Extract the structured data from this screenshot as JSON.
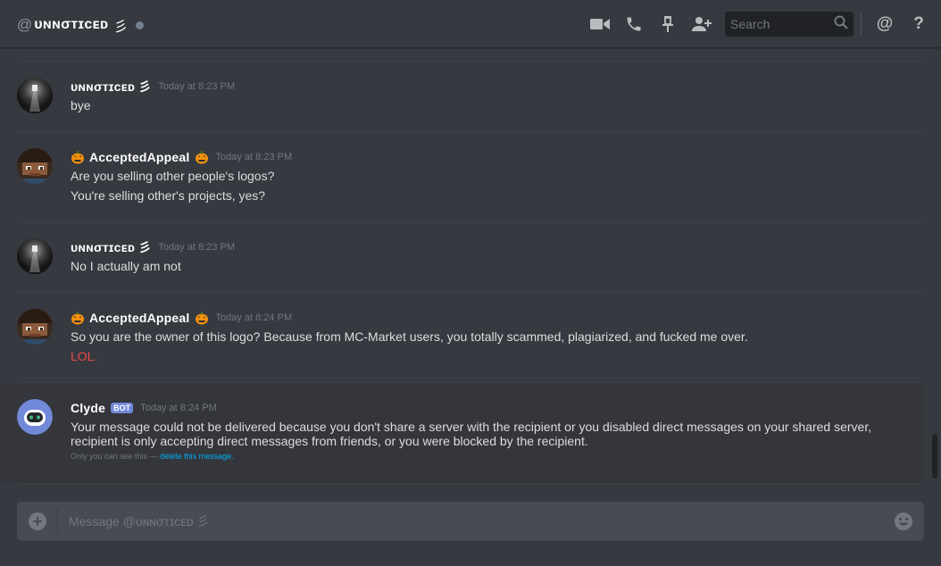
{
  "header": {
    "at_symbol": "@",
    "channel_name": "ᴜɴɴσᴛɪcᴇᴅ",
    "channel_suffix": "彡",
    "status_color": "#747f8d",
    "search_placeholder": "Search",
    "icons": [
      "video-call-icon",
      "voice-call-icon",
      "pin-icon",
      "add-friend-icon",
      "search-icon",
      "mention-icon",
      "help-icon"
    ],
    "mention_label": "@",
    "help_label": "?"
  },
  "messages": [
    {
      "author": "ᴜɴɴσᴛɪcᴇᴅ 彡",
      "timestamp": "Today at 8:23 PM",
      "lines": [
        "bye"
      ]
    },
    {
      "author": "AcceptedAppeal",
      "timestamp": "Today at 8:23 PM",
      "lines": [
        "Are you selling other people's logos?",
        "You're selling other's projects, yes?"
      ]
    },
    {
      "author": "ᴜɴɴσᴛɪcᴇᴅ 彡",
      "timestamp": "Today at 8:23 PM",
      "lines": [
        "No I actually am not"
      ]
    },
    {
      "author": "AcceptedAppeal",
      "timestamp": "Today at 8:24 PM",
      "lines": [
        "So you are the owner of this logo? Because from MC-Market users, you totally scammed, plagiarized, and fucked me over.",
        "LOL."
      ]
    },
    {
      "author": "Clyde",
      "bot_tag": "BOT",
      "timestamp": "Today at 8:24 PM",
      "lines": [
        "Your message could not be delivered because you don't share a server with the recipient or you disabled direct messages on your shared server, recipient is only accepting direct messages from friends, or you were blocked by the recipient."
      ],
      "ephemeral_text": "Only you can see this — ",
      "ephemeral_link": "delete this message."
    }
  ],
  "input": {
    "placeholder": "Message @ᴜɴɴσᴛɪcᴇᴅ 彡"
  },
  "colors": {
    "background": "#36393f",
    "header_border": "#28292d",
    "input_bg": "#484b51",
    "timestamp": "#72767d",
    "red_text": "#f04747",
    "link": "#00b0f4",
    "bot_tag": "#7289da"
  }
}
